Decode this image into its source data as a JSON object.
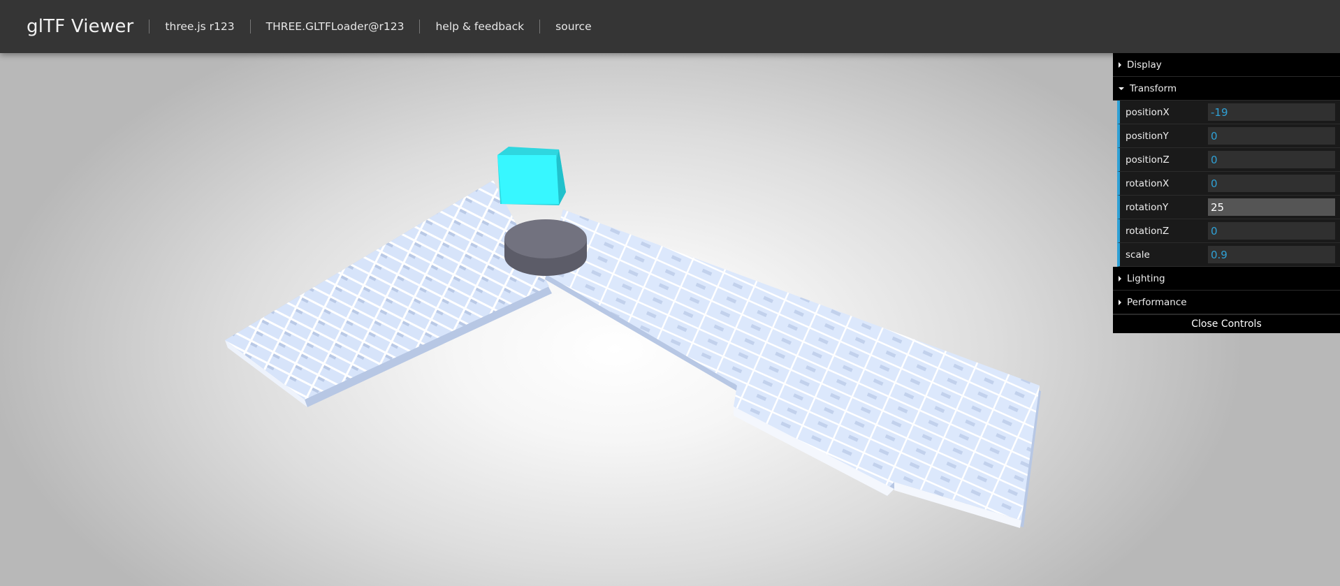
{
  "header": {
    "title": "glTF Viewer",
    "links": [
      "three.js r123",
      "THREE.GLTFLoader@r123",
      "help & feedback",
      "source"
    ]
  },
  "gui": {
    "display_label": "Display",
    "transform_label": "Transform",
    "fields": [
      {
        "label": "positionX",
        "value": "-19"
      },
      {
        "label": "positionY",
        "value": "0"
      },
      {
        "label": "positionZ",
        "value": "0"
      },
      {
        "label": "rotationX",
        "value": "0"
      },
      {
        "label": "rotationY",
        "value": "25"
      },
      {
        "label": "rotationZ",
        "value": "0"
      },
      {
        "label": "scale",
        "value": "0.9"
      }
    ],
    "lighting_label": "Lighting",
    "performance_label": "Performance",
    "close_label": "Close Controls"
  },
  "colors": {
    "header_bg": "#353535",
    "accent": "#2fa1d6",
    "floor": "#d9e6fb",
    "cube": "#36f6ff",
    "cylinder": "#6f6f7b"
  },
  "icons": [
    "triangle-right-icon",
    "triangle-down-icon"
  ]
}
